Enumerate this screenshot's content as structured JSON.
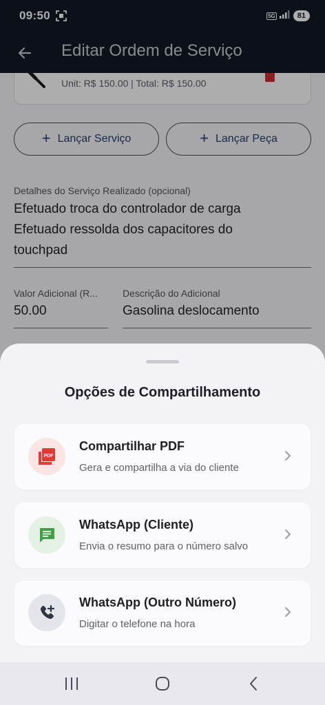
{
  "status_bar": {
    "time": "09:50",
    "network": "5G",
    "battery": "81",
    "icons": [
      "screenshot-icon",
      "signal-icon",
      "battery-icon"
    ]
  },
  "app_bar": {
    "title": "Editar Ordem de Serviço",
    "back_icon": "arrow-left-icon"
  },
  "item_card": {
    "price_line": "Unit: R$ 150.00 | Total: R$ 150.00",
    "icon": "wrench-icon"
  },
  "actions": {
    "add_service": "Lançar Serviço",
    "add_part": "Lançar Peça"
  },
  "details": {
    "label": "Detalhes do Serviço Realizado (opcional)",
    "lines": [
      "Efetuado troca do controlador de carga",
      "Efetuado ressolda dos capacitores do",
      "touchpad"
    ]
  },
  "additional": {
    "value_label": "Valor Adicional (R...",
    "value": "50.00",
    "description_label": "Descrição do Adicional",
    "description": "Gasolina deslocamento"
  },
  "share_sheet": {
    "title": "Opções de Compartilhamento",
    "options": [
      {
        "title": "Compartilhar PDF",
        "subtitle": "Gera e compartilha a via do cliente",
        "icon": "pdf-icon",
        "icon_color": "#e53935",
        "icon_bg": "#fbe4e4"
      },
      {
        "title": "WhatsApp (Cliente)",
        "subtitle": "Envia o resumo para o número salvo",
        "icon": "message-icon",
        "icon_color": "#43a047",
        "icon_bg": "#e3f2e4"
      },
      {
        "title": "WhatsApp (Outro Número)",
        "subtitle": "Digitar o telefone na hora",
        "icon": "phone-add-icon",
        "icon_color": "#2f3542",
        "icon_bg": "#e4e5ea"
      }
    ]
  },
  "nav_bar": {
    "buttons": [
      "recent-apps-icon",
      "home-icon",
      "back-icon"
    ]
  }
}
